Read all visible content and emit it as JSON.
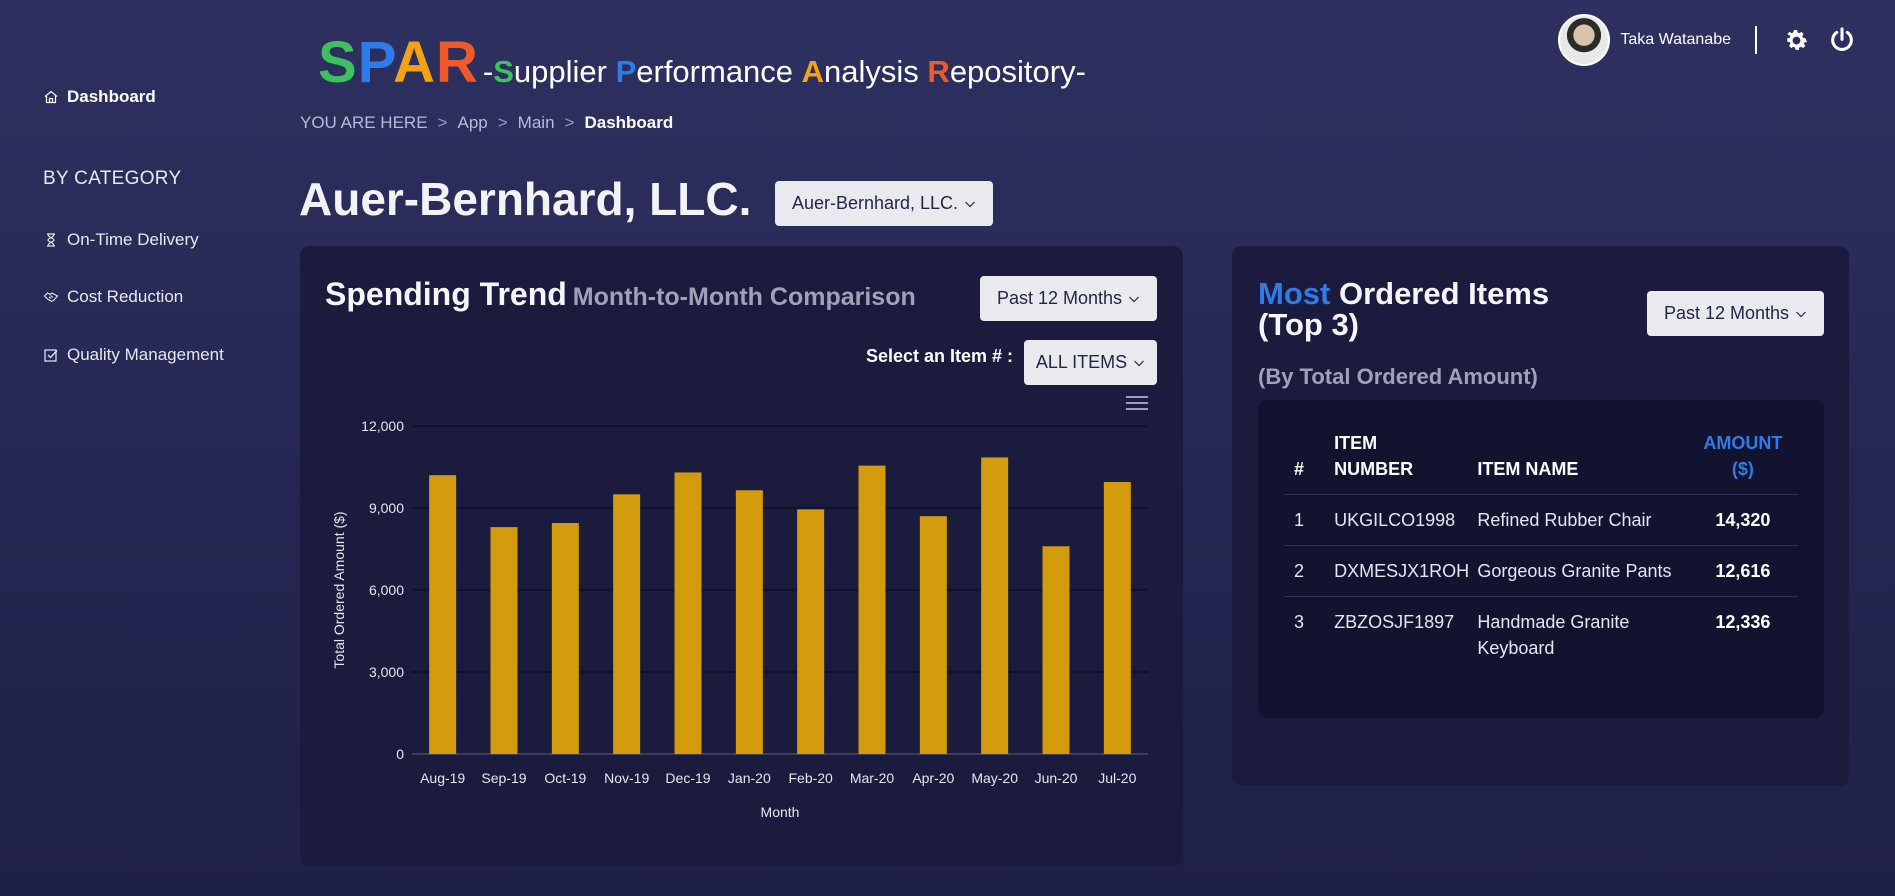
{
  "sidebar": {
    "dashboard": "Dashboard",
    "heading": "BY CATEGORY",
    "items": [
      {
        "label": "On-Time Delivery",
        "icon": "hourglass-icon"
      },
      {
        "label": "Cost Reduction",
        "icon": "handshake-icon"
      },
      {
        "label": "Quality Management",
        "icon": "checkbox-icon"
      }
    ]
  },
  "logo": {
    "letters": [
      {
        "ch": "S",
        "color": "#3fbf5f"
      },
      {
        "ch": "P",
        "color": "#2f7be8"
      },
      {
        "ch": "A",
        "color": "#f1a316"
      },
      {
        "ch": "R",
        "color": "#ef5a2a"
      }
    ],
    "dash_open": "-",
    "words": [
      {
        "cap": "S",
        "rest": "upplier ",
        "color": "#3fbf5f"
      },
      {
        "cap": "P",
        "rest": "erformance ",
        "color": "#2f7be8"
      },
      {
        "cap": "A",
        "rest": "nalysis ",
        "color": "#f1a316"
      },
      {
        "cap": "R",
        "rest": "epository",
        "color": "#ef5a2a"
      }
    ],
    "dash_close": "-"
  },
  "breadcrumb": {
    "prefix": "YOU ARE HERE",
    "sep": ">",
    "app": "App",
    "main": "Main",
    "current": "Dashboard"
  },
  "user": {
    "name": "Taka Watanabe"
  },
  "company": {
    "title": "Auer-Bernhard, LLC.",
    "selector": "Auer-Bernhard, LLC."
  },
  "spending": {
    "title": "Spending Trend",
    "subtitle": "Month-to-Month Comparison",
    "period": "Past 12 Months",
    "select_label": "Select an Item # :",
    "item_select": "ALL ITEMS"
  },
  "chart_data": {
    "type": "bar",
    "categories": [
      "Aug-19",
      "Sep-19",
      "Oct-19",
      "Nov-19",
      "Dec-19",
      "Jan-20",
      "Feb-20",
      "Mar-20",
      "Apr-20",
      "May-20",
      "Jun-20",
      "Jul-20"
    ],
    "values": [
      10200,
      8300,
      8450,
      9500,
      10300,
      9650,
      8950,
      10550,
      8700,
      10850,
      7600,
      9950
    ],
    "ylabel": "Total Ordered Amount ($)",
    "xlabel": "Month",
    "ylim": [
      0,
      12000
    ],
    "yticks": [
      0,
      3000,
      6000,
      9000,
      12000
    ],
    "ytick_labels": [
      "0",
      "3,000",
      "6,000",
      "9,000",
      "12,000"
    ],
    "bar_color": "#d49b0d",
    "grid": true
  },
  "top_items": {
    "title_accent": "Most",
    "title_rest": "Ordered Items",
    "title_line2": "(Top 3)",
    "subtitle": "(By Total Ordered Amount)",
    "period": "Past 12 Months",
    "headers": {
      "num": "#",
      "item_number_1": "ITEM",
      "item_number_2": "NUMBER",
      "item_name": "ITEM NAME",
      "amount_1": "AMOUNT",
      "amount_2": "($)"
    },
    "rows": [
      {
        "rank": "1",
        "number": "UKGILCO1998",
        "name": "Refined Rubber Chair",
        "amount": "14,320"
      },
      {
        "rank": "2",
        "number": "DXMESJX1ROH",
        "name": "Gorgeous Granite Pants",
        "amount": "12,616"
      },
      {
        "rank": "3",
        "number": "ZBZOSJF1897",
        "name": "Handmade Granite Keyboard",
        "amount": "12,336"
      }
    ]
  }
}
